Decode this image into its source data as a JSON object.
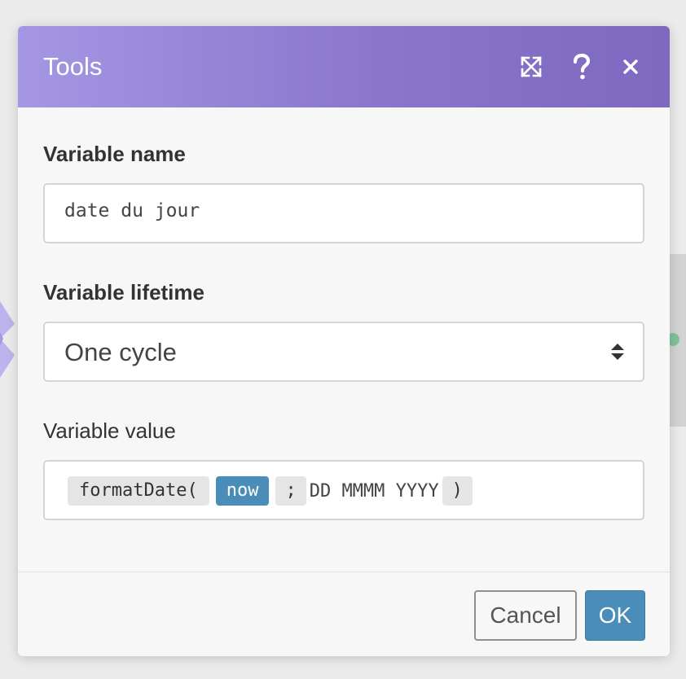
{
  "dialog": {
    "title": "Tools",
    "header_icons": [
      "expand-icon",
      "help-icon",
      "close-icon"
    ],
    "header_gradient": [
      "#a597e4",
      "#7e68c0"
    ]
  },
  "fields": {
    "variable_name": {
      "label": "Variable name",
      "value": "date du jour"
    },
    "variable_lifetime": {
      "label": "Variable lifetime",
      "selected": "One cycle"
    },
    "variable_value": {
      "label": "Variable value",
      "tokens": {
        "function": "formatDate(",
        "variable": "now",
        "separator": ";",
        "format": "DD MMMM YYYY",
        "close": ")"
      }
    }
  },
  "footer": {
    "cancel_label": "Cancel",
    "ok_label": "OK"
  },
  "colors": {
    "accent": "#4a8db8",
    "token_bg": "#e5e5e5"
  }
}
